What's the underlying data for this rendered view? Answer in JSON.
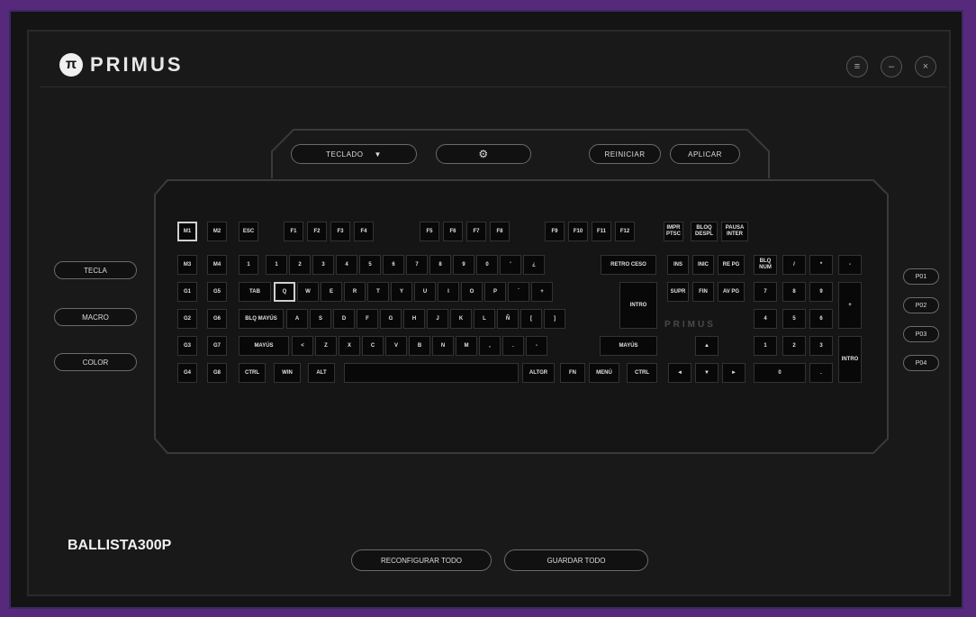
{
  "brand": {
    "name": "PRIMUS",
    "mark": "π"
  },
  "window_controls": [
    {
      "name": "menu-icon",
      "glyph": "≡"
    },
    {
      "name": "minimize-icon",
      "glyph": "–"
    },
    {
      "name": "close-icon",
      "glyph": "×"
    }
  ],
  "toolbar": {
    "mode_select": "TECLADO",
    "mode_arrow": "▼",
    "settings_glyph": "⚙",
    "reset": "REINICIAR",
    "apply": "APLICAR"
  },
  "side_buttons": [
    "TECLA",
    "MACRO",
    "COLOR"
  ],
  "profile_buttons": [
    "P01",
    "P02",
    "P03",
    "P04"
  ],
  "keyboard_brand": "PRIMUS",
  "keys": {
    "m1": "M1",
    "m2": "M2",
    "esc": "ESC",
    "f1": "F1",
    "f2": "F2",
    "f3": "F3",
    "f4": "F4",
    "f5": "F5",
    "f6": "F6",
    "f7": "F7",
    "f8": "F8",
    "f9": "F9",
    "f10": "F10",
    "f11": "F11",
    "f12": "F12",
    "impr": "IMPR PTSC",
    "bloq_desp": "BLOQ DESPL",
    "pausa": "PAUSA INTER",
    "m3": "M3",
    "m4": "M4",
    "grave": "1",
    "n1": "1",
    "n2": "2",
    "n3": "3",
    "n4": "4",
    "n5": "5",
    "n6": "6",
    "n7": "7",
    "n8": "8",
    "n9": "9",
    "n0": "0",
    "apos": "'",
    "inv_ex": "¿",
    "retro": "RETRO CESO",
    "ins": "INS",
    "inic": "INIC",
    "re_pag": "RE PG",
    "bloq_num": "BLQ NUM",
    "np_div": "/",
    "np_mul": "*",
    "np_min": "-",
    "g1": "G1",
    "g5": "G5",
    "tab": "TAB",
    "q": "Q",
    "w": "W",
    "e": "E",
    "r": "R",
    "t": "T",
    "y": "Y",
    "u": "U",
    "i": "I",
    "o": "O",
    "p": "P",
    "acute": "´",
    "plus": "+",
    "intro": "INTRO",
    "supr": "SUPR",
    "fin": "FIN",
    "av_pag": "AV PG",
    "np7": "7",
    "np8": "8",
    "np9": "9",
    "np_plus": "+",
    "g2": "G2",
    "g6": "G6",
    "bloq_mayus": "BLQ MAYÚS",
    "a": "A",
    "s": "S",
    "d": "D",
    "f": "F",
    "g": "G",
    "h": "H",
    "j": "J",
    "k": "K",
    "l": "L",
    "ntilde": "Ñ",
    "lbr": "[",
    "rbr": "]",
    "np4": "4",
    "np5": "5",
    "np6": "6",
    "g3": "G3",
    "g7": "G7",
    "lshift": "MAYÚS",
    "lt": "<",
    "z": "Z",
    "x": "X",
    "c": "C",
    "v": "V",
    "b": "B",
    "n": "N",
    "m": "M",
    "comma": ",",
    "dot": ".",
    "dash": "-",
    "rshift": "MAYÚS",
    "up": "▲",
    "np1": "1",
    "np2": "2",
    "np3": "3",
    "np_enter": "INTRO",
    "g4": "G4",
    "g8": "G8",
    "lctrl": "CTRL",
    "win": "WIN",
    "alt": "ALT",
    "space": "",
    "altgr": "ALTGR",
    "fn": "FN",
    "menu": "MENÚ",
    "rctrl": "CTRL",
    "left": "◄",
    "down": "▼",
    "right": "►",
    "np0": "0",
    "np_dot": "."
  },
  "footer": {
    "model": "BALLISTA300P",
    "reconfigure_all": "RECONFIGURAR TODO",
    "save_all": "GUARDAR TODO"
  }
}
